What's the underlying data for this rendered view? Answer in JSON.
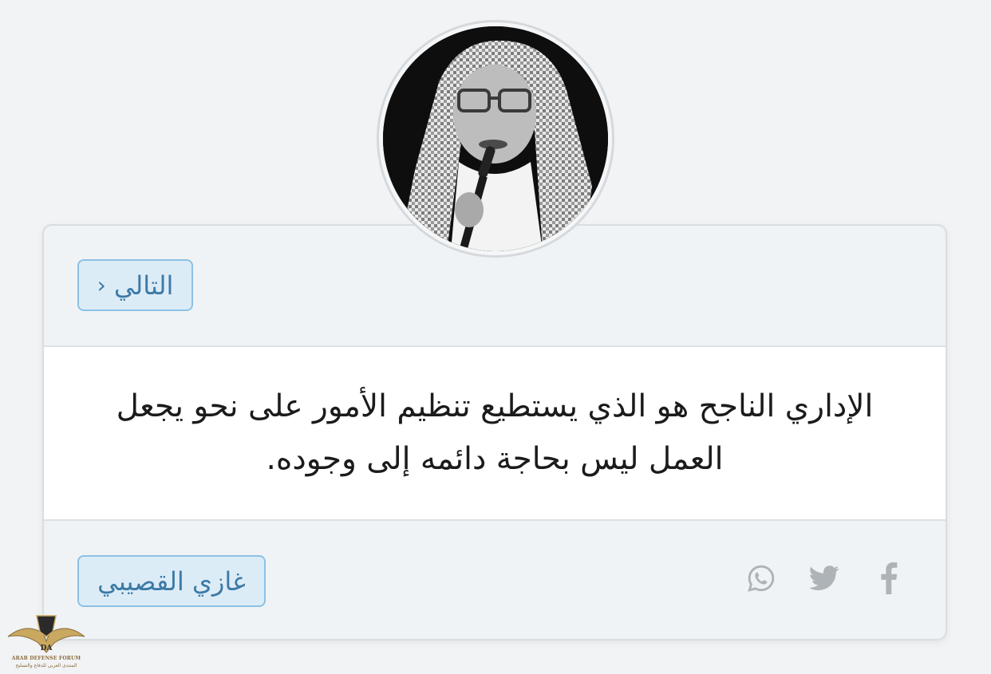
{
  "navigation": {
    "next_label": "التالي",
    "next_chevron": "‹"
  },
  "quote": {
    "text": "الإداري الناجح هو الذي يستطيع تنظيم الأمور على نحو يجعل العمل ليس بحاجة دائمه إلى وجوده."
  },
  "author": {
    "name": "غازي القصيبي"
  },
  "share": {
    "icons": [
      "whatsapp-icon",
      "twitter-icon",
      "facebook-icon"
    ],
    "icon_color": "#aeb3b8"
  },
  "watermark": {
    "title": "ARAB DEFENSE FORUM",
    "subtitle": "المنتدى العربي للدفاع والتسليح",
    "logo_text": "DA"
  },
  "colors": {
    "background": "#f1f3f5",
    "card": "#f0f3f6",
    "button_bg": "#dcecf7",
    "button_border": "#8cc1e4",
    "button_text": "#3d7aa6"
  }
}
